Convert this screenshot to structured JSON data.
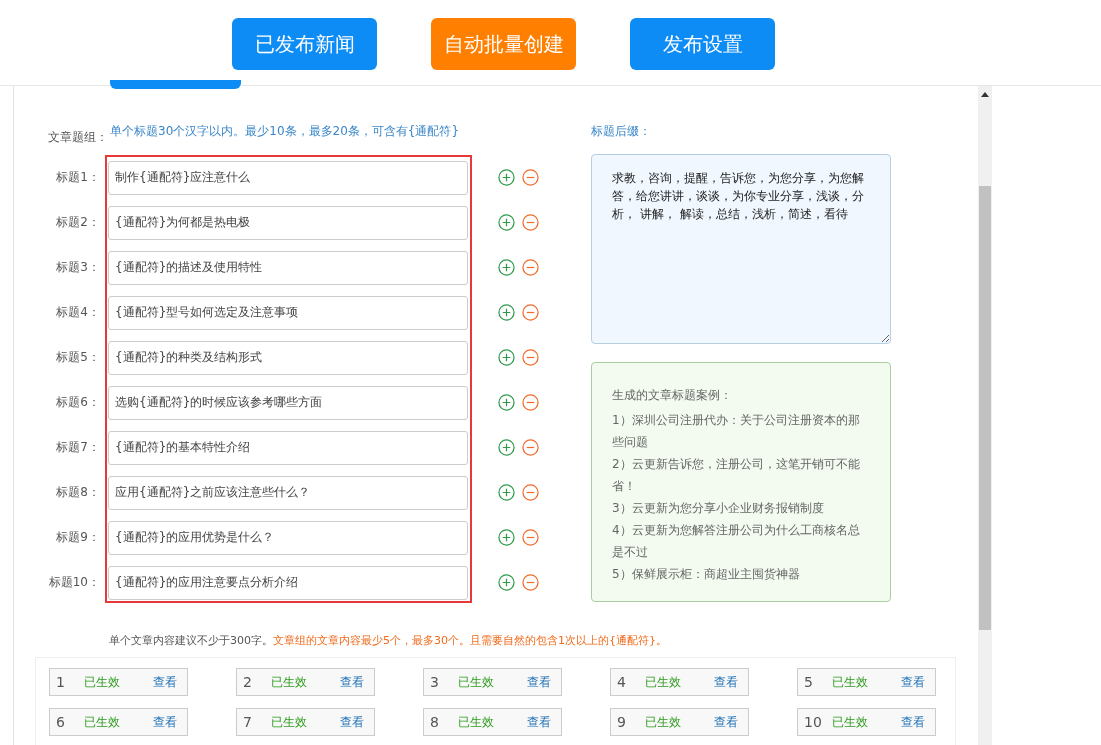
{
  "top_buttons": [
    {
      "label": "已发布新闻",
      "kind": "primary"
    },
    {
      "label": "自动批量创建",
      "kind": "accent"
    },
    {
      "label": "发布设置",
      "kind": "primary"
    }
  ],
  "title_group": {
    "label": "文章题组：",
    "hint": "单个标题30个汉字以内。最少10条，最多20条，可含有{通配符}",
    "titles": [
      {
        "label": "标题1：",
        "value": "制作{通配符}应注意什么"
      },
      {
        "label": "标题2：",
        "value": "{通配符}为何都是热电极"
      },
      {
        "label": "标题3：",
        "value": "{通配符}的描述及使用特性"
      },
      {
        "label": "标题4：",
        "value": "{通配符}型号如何选定及注意事项"
      },
      {
        "label": "标题5：",
        "value": "{通配符}的种类及结构形式"
      },
      {
        "label": "标题6：",
        "value": "选购{通配符}的时候应该参考哪些方面"
      },
      {
        "label": "标题7：",
        "value": "{通配符}的基本特性介绍"
      },
      {
        "label": "标题8：",
        "value": "应用{通配符}之前应该注意些什么？"
      },
      {
        "label": "标题9：",
        "value": "{通配符}的应用优势是什么？"
      },
      {
        "label": "标题10：",
        "value": "{通配符}的应用注意要点分析介绍"
      }
    ]
  },
  "suffix": {
    "label": "标题后缀：",
    "value": "求教，咨询，提醒，告诉您，为您分享，为您解答，给您讲讲，谈谈，为你专业分享，浅谈，分析， 讲解， 解读，总结，浅析，简述，看待"
  },
  "examples": {
    "heading": "生成的文章标题案例：",
    "items": [
      "1）深圳公司注册代办：关于公司注册资本的那些问题",
      "2）云更新告诉您，注册公司，这笔开销可不能省！",
      "3）云更新为您分享小企业财务报销制度",
      "4）云更新为您解答注册公司为什么工商核名总是不过",
      "5）保鲜展示柜：商超业主囤货神器"
    ]
  },
  "content_note": {
    "plain": "单个文章内容建议不少于300字。",
    "warning": "文章组的文章内容最少5个，最多30个。且需要自然的包含1次以上的{通配符}。"
  },
  "contents": [
    {
      "number": "1",
      "status": "已生效",
      "action": "查看"
    },
    {
      "number": "2",
      "status": "已生效",
      "action": "查看"
    },
    {
      "number": "3",
      "status": "已生效",
      "action": "查看"
    },
    {
      "number": "4",
      "status": "已生效",
      "action": "查看"
    },
    {
      "number": "5",
      "status": "已生效",
      "action": "查看"
    },
    {
      "number": "6",
      "status": "已生效",
      "action": "查看"
    },
    {
      "number": "7",
      "status": "已生效",
      "action": "查看"
    },
    {
      "number": "8",
      "status": "已生效",
      "action": "查看"
    },
    {
      "number": "9",
      "status": "已生效",
      "action": "查看"
    },
    {
      "number": "10",
      "status": "已生效",
      "action": "查看"
    }
  ]
}
